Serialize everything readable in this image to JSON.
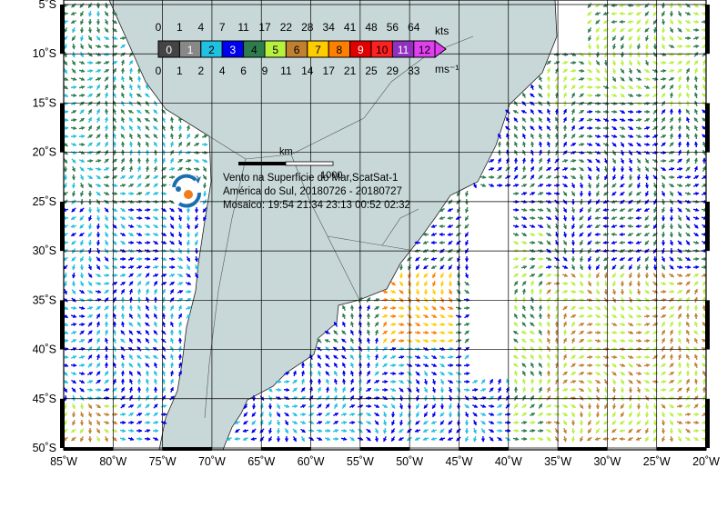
{
  "map": {
    "title_lines": [
      "Vento na Superfície do Mar,ScatSat-1",
      "América do Sul, 20180726 - 20180727",
      "Mosaico: 19:54 21:34 23:13 00:52 02:32"
    ],
    "lat_labels": [
      "5˚S",
      "10˚S",
      "15˚S",
      "20˚S",
      "25˚S",
      "30˚S",
      "35˚S",
      "40˚S",
      "45˚S",
      "50˚S"
    ],
    "lon_labels": [
      "85˚W",
      "80˚W",
      "75˚W",
      "70˚W",
      "65˚W",
      "60˚W",
      "55˚W",
      "50˚W",
      "45˚W",
      "40˚W",
      "35˚W",
      "30˚W",
      "25˚W",
      "20˚W"
    ],
    "scale_bar": {
      "unit": "km",
      "value": "1000"
    },
    "colors": {
      "land": "#c8d8d8",
      "ocean": "#ffffff",
      "grid": "#000000"
    },
    "logo_icon": "cptec-logo-icon"
  },
  "legend": {
    "top_unit": "kts",
    "bottom_unit": "ms⁻¹",
    "top_values": [
      "0",
      "1",
      "4",
      "7",
      "11",
      "17",
      "22",
      "28",
      "34",
      "41",
      "48",
      "56",
      "64"
    ],
    "bottom_values": [
      "0",
      "1",
      "2",
      "4",
      "6",
      "9",
      "11",
      "14",
      "17",
      "21",
      "25",
      "29",
      "33"
    ],
    "classes": [
      {
        "label": "0",
        "color": "#444444"
      },
      {
        "label": "1",
        "color": "#888888"
      },
      {
        "label": "2",
        "color": "#22c0e0"
      },
      {
        "label": "3",
        "color": "#0000ee"
      },
      {
        "label": "4",
        "color": "#2e7d4f"
      },
      {
        "label": "5",
        "color": "#b8f040"
      },
      {
        "label": "6",
        "color": "#c08030"
      },
      {
        "label": "7",
        "color": "#ffcc00"
      },
      {
        "label": "8",
        "color": "#ff8000"
      },
      {
        "label": "9",
        "color": "#e00000"
      },
      {
        "label": "10",
        "color": "#ff2020"
      },
      {
        "label": "11",
        "color": "#9030c0"
      },
      {
        "label": "12",
        "color": "#e040f0"
      }
    ]
  }
}
